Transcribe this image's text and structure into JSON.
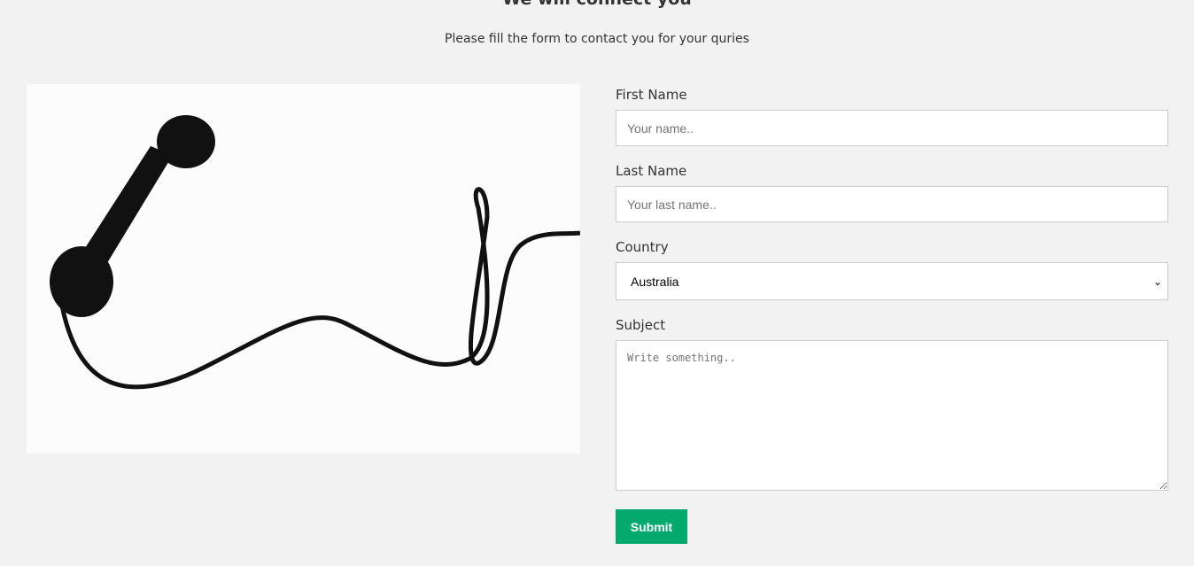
{
  "header": {
    "title": "We will connect you",
    "subtitle": "Please fill the form to contact you for your quries"
  },
  "form": {
    "first_name_label": "First Name",
    "first_name_placeholder": "Your name..",
    "last_name_label": "Last Name",
    "last_name_placeholder": "Your last name..",
    "country_label": "Country",
    "country_value": "Australia",
    "subject_label": "Subject",
    "subject_placeholder": "Write something..",
    "submit_label": "Submit"
  }
}
